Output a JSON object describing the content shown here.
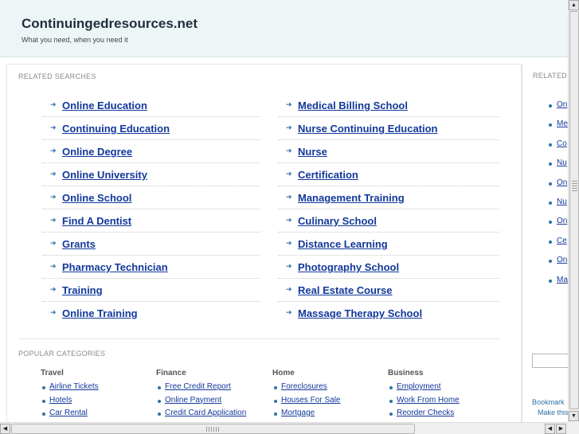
{
  "header": {
    "title": "Continuingedresources.net",
    "tagline": "What you need, when you need it"
  },
  "related": {
    "label": "RELATED SEARCHES",
    "left": [
      "Online Education",
      "Continuing Education",
      "Online Degree",
      "Online University",
      "Online School",
      "Find A Dentist",
      "Grants",
      "Pharmacy Technician",
      "Training",
      "Online Training"
    ],
    "right": [
      "Medical Billing School",
      "Nurse Continuing Education",
      "Nurse",
      "Certification",
      "Management Training",
      "Culinary School",
      "Distance Learning",
      "Photography School",
      "Real Estate Course",
      "Massage Therapy School"
    ]
  },
  "popular": {
    "label": "POPULAR CATEGORIES",
    "categories": [
      {
        "title": "Travel",
        "items": [
          "Airline Tickets",
          "Hotels",
          "Car Rental"
        ]
      },
      {
        "title": "Finance",
        "items": [
          "Free Credit Report",
          "Online Payment",
          "Credit Card Application"
        ]
      },
      {
        "title": "Home",
        "items": [
          "Foreclosures",
          "Houses For Sale",
          "Mortgage"
        ]
      },
      {
        "title": "Business",
        "items": [
          "Employment",
          "Work From Home",
          "Reorder Checks"
        ]
      }
    ]
  },
  "side": {
    "label": "RELATED",
    "items": [
      "On",
      "Me",
      "Co",
      "Nu",
      "On",
      "Nu",
      "On",
      "Ce",
      "On",
      "Ma"
    ],
    "bookmark": "Bookmark",
    "make_this": "Make this"
  },
  "icons": {
    "arrow": "triangle-right-icon",
    "bullet": "bullet-icon",
    "scroll_up": "chevron-up-icon",
    "scroll_down": "chevron-down-icon",
    "scroll_left": "chevron-left-icon",
    "scroll_right": "chevron-right-icon"
  },
  "colors": {
    "link": "#12389a",
    "accent": "#2a73a8",
    "header_bg": "#eef5f7"
  }
}
